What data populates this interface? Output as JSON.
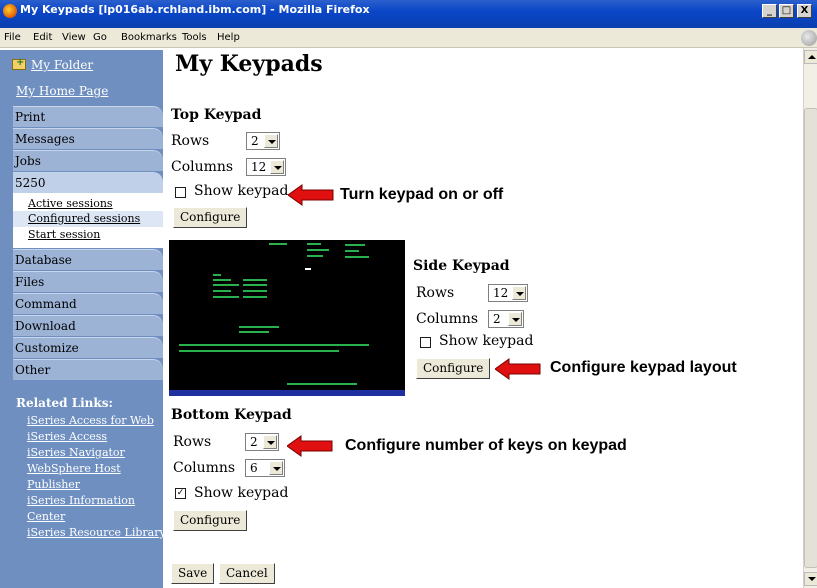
{
  "window": {
    "title": "My Keypads [lp016ab.rchland.ibm.com] - Mozilla Firefox",
    "minimize": "_",
    "maximize": "□",
    "close": "X"
  },
  "menubar": {
    "items": [
      "File",
      "Edit",
      "View",
      "Go",
      "Bookmarks",
      "Tools",
      "Help"
    ]
  },
  "sidebar": {
    "folder_link": "My Folder",
    "home_link": "My Home Page",
    "nav": [
      "Print",
      "Messages",
      "Jobs",
      "5250",
      "Database",
      "Files",
      "Command",
      "Download",
      "Customize",
      "Other"
    ],
    "subitems": [
      "Active sessions",
      "Configured sessions",
      "Start session"
    ],
    "related_title": "Related Links:",
    "related_links": [
      "iSeries Access for Web",
      "iSeries Access",
      "iSeries Navigator",
      "WebSphere Host",
      "Publisher",
      "iSeries Information",
      "Center",
      "iSeries Resource Library"
    ]
  },
  "content": {
    "page_title": "My Keypads",
    "top": {
      "title": "Top Keypad",
      "rows_label": "Rows",
      "rows_value": "2",
      "cols_label": "Columns",
      "cols_value": "12",
      "show_label": "Show keypad",
      "show_checked": false,
      "configure": "Configure"
    },
    "side": {
      "title": "Side Keypad",
      "rows_label": "Rows",
      "rows_value": "12",
      "cols_label": "Columns",
      "cols_value": "2",
      "show_label": "Show keypad",
      "show_checked": false,
      "configure": "Configure"
    },
    "bottom": {
      "title": "Bottom Keypad",
      "rows_label": "Rows",
      "rows_value": "2",
      "cols_label": "Columns",
      "cols_value": "6",
      "show_label": "Show keypad",
      "show_checked": true,
      "configure": "Configure"
    },
    "save": "Save",
    "cancel": "Cancel",
    "checkmark": "✓"
  },
  "callouts": {
    "turn": "Turn keypad on or off",
    "layout": "Configure keypad layout",
    "keys": "Configure number of keys on keypad"
  },
  "colors": {
    "sidebar": "#6e8fbf",
    "callout_arrow": "#e01010",
    "terminal_text": "#2fd15a"
  }
}
